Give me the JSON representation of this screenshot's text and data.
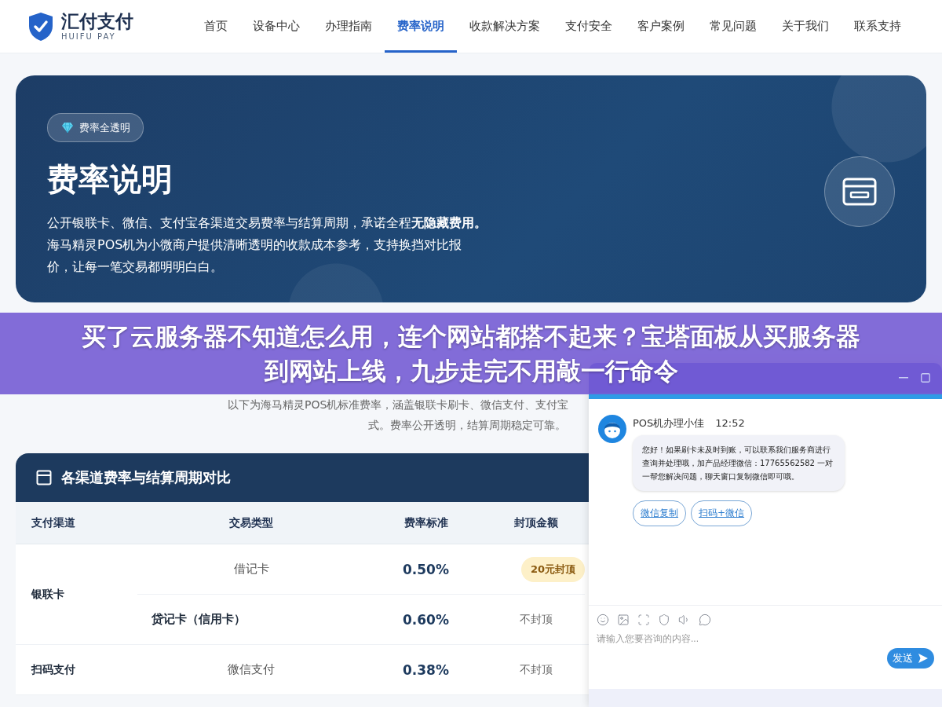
{
  "nav": {
    "brand": "汇付支付",
    "brand_sub": "HUIFU PAY",
    "items": [
      {
        "label": "首页",
        "selected": false
      },
      {
        "label": "设备中心",
        "selected": false
      },
      {
        "label": "办理指南",
        "selected": false
      },
      {
        "label": "费率说明",
        "selected": true
      },
      {
        "label": "收款解决方案",
        "selected": false
      },
      {
        "label": "支付安全",
        "selected": false
      },
      {
        "label": "客户案例",
        "selected": false
      },
      {
        "label": "常见问题",
        "selected": false
      },
      {
        "label": "关于我们",
        "selected": false
      },
      {
        "label": "联系支持",
        "selected": false
      }
    ]
  },
  "hero": {
    "badge": "费率全透明",
    "title": "费率说明",
    "description": "公开银联卡、微信、支付宝各渠道交易费率与结算周期，承诺全程**无隐藏费用。**海马精灵POS机为小微商户提供清晰透明的收款成本参考，支持换挡对比报价，让每一笔交易都明明白白。"
  },
  "intro": {
    "lines": [
      "以下为海马精灵POS机标准费率，涵盖银联卡刷卡、微信支付、支付宝",
      "式。费率公开透明，结算周期稳定可靠。"
    ]
  },
  "rate_table": {
    "title": "各渠道费率与结算周期对比",
    "columns": [
      "支付渠道",
      "交易类型",
      "费率标准",
      "封顶金额"
    ],
    "groups": [
      {
        "channel": "银联卡",
        "rows": [
          {
            "type": "借记卡",
            "emphasis": false,
            "rate": "0.50%",
            "cap": "20元封顶",
            "kind": "badge"
          },
          {
            "type": "贷记卡（信用卡）",
            "emphasis": true,
            "rate": "0.60%",
            "cap": "不封顶",
            "kind": "plain"
          }
        ]
      },
      {
        "channel": "扫码支付",
        "rows": [
          {
            "type": "微信支付",
            "emphasis": false,
            "rate": "0.38%",
            "cap": "不封顶",
            "kind": "plain"
          }
        ]
      }
    ]
  },
  "banner": {
    "headline_lines": [
      "买了云服务器不知道怎么用，连个网站都搭不起来？宝塔面板从买服务器",
      "到网站上线，九步走完不用敲一行命令"
    ]
  },
  "chat": {
    "messages": [
      {
        "sender": "POS机办理小佳",
        "time": "12:52",
        "text": "您好！如果刷卡未及时到账，可以联系我们服务商进行查询并处理哦，加产品经理微信：17765562582 一对一帮您解决问题，聊天窗口复制微信即可哦。",
        "actions": [
          "微信复制",
          "扫码+微信"
        ]
      }
    ],
    "input": {
      "placeholder": "请输入您要咨询的内容..."
    },
    "send": "发送"
  }
}
